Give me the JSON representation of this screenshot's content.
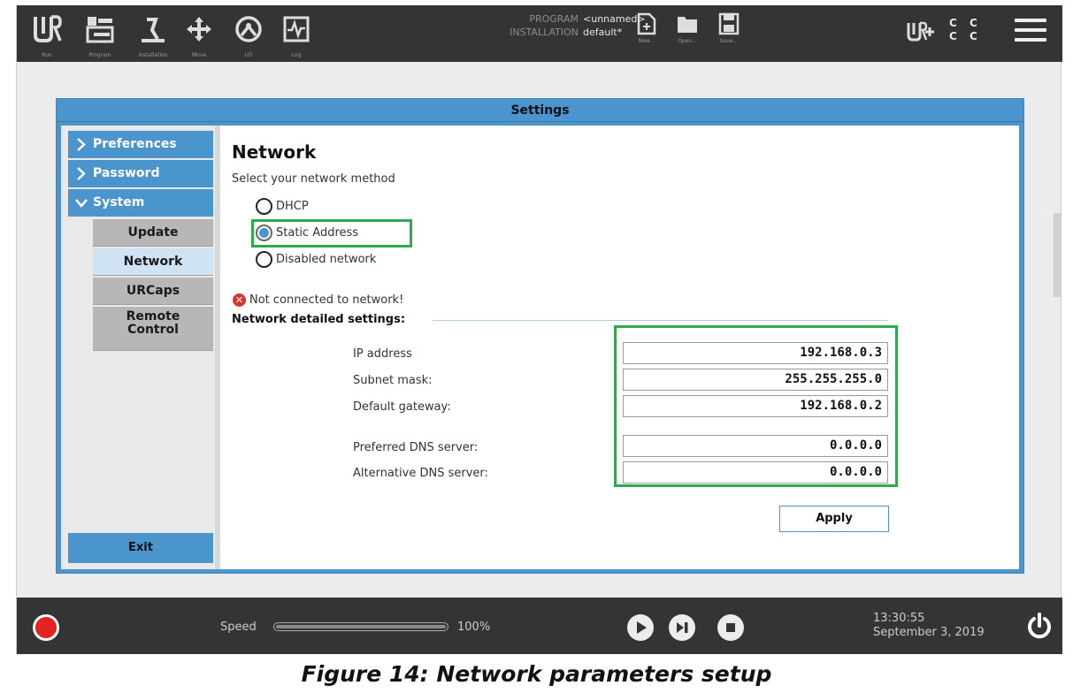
{
  "topbar": {
    "buttons": [
      {
        "label": "Run",
        "icon": "ur-logo-icon"
      },
      {
        "label": "Program",
        "icon": "program-icon"
      },
      {
        "label": "Installation",
        "icon": "installation-icon"
      },
      {
        "label": "Move",
        "icon": "move-icon"
      },
      {
        "label": "I/O",
        "icon": "io-icon"
      },
      {
        "label": "Log",
        "icon": "log-icon"
      }
    ],
    "program_label": "PROGRAM",
    "program_value": "<unnamed>",
    "installation_label": "INSTALLATION",
    "installation_value": "default*",
    "file_buttons": [
      {
        "label": "New...",
        "icon": "new-file-icon"
      },
      {
        "label": "Open...",
        "icon": "open-folder-icon"
      },
      {
        "label": "Save...",
        "icon": "save-icon"
      }
    ],
    "cc_text": "C C C C"
  },
  "dialog": {
    "title": "Settings",
    "nav": [
      {
        "label": "Preferences",
        "expanded": false
      },
      {
        "label": "Password",
        "expanded": false
      },
      {
        "label": "System",
        "expanded": true
      }
    ],
    "subnav": [
      {
        "label": "Update",
        "selected": false
      },
      {
        "label": "Network",
        "selected": true
      },
      {
        "label": "URCaps",
        "selected": false
      },
      {
        "label": "Remote Control",
        "selected": false
      }
    ],
    "exit_label": "Exit"
  },
  "network": {
    "title": "Network",
    "subtitle": "Select your network method",
    "methods": [
      {
        "label": "DHCP",
        "selected": false
      },
      {
        "label": "Static Address",
        "selected": true
      },
      {
        "label": "Disabled network",
        "selected": false
      }
    ],
    "status": "Not connected to network!",
    "section_title": "Network detailed settings:",
    "fields": [
      {
        "label": "IP address",
        "value": "192.168.0.3"
      },
      {
        "label": "Subnet mask:",
        "value": "255.255.255.0"
      },
      {
        "label": "Default gateway:",
        "value": "192.168.0.2"
      },
      {
        "label": "Preferred DNS server:",
        "value": "0.0.0.0"
      },
      {
        "label": "Alternative DNS server:",
        "value": "0.0.0.0"
      }
    ],
    "apply_label": "Apply"
  },
  "bottombar": {
    "speed_label": "Speed",
    "speed_value": "100%",
    "speed_fraction": 1.0,
    "time": "13:30:55",
    "date": "September 3, 2019"
  },
  "caption": "Figure 14: Network parameters setup",
  "colors": {
    "accent_blue": "#4a95ce",
    "highlight_green": "#2fa84f",
    "error_red": "#d9342b",
    "bar_dark": "#333435"
  }
}
